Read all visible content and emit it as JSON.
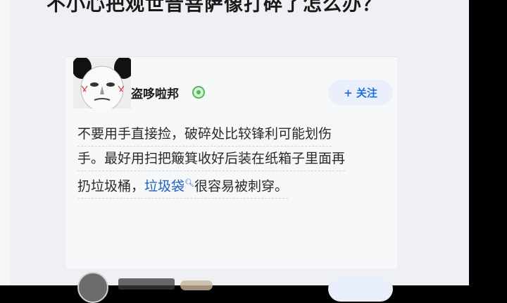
{
  "question": {
    "title": "不小心把观世音菩萨像打碎了怎么办？"
  },
  "answer": {
    "author": "盗哆啦邦",
    "author_badge_icon": "verified-badge-icon",
    "follow_label": "+ 关注",
    "lines": [
      "不要用手直接捡，破碎处比较锋利可能划伤",
      "手。最好用扫把簸箕收好后装在纸箱子里面再"
    ],
    "line3_before": "扔垃圾桶，",
    "keyword_link": "垃圾袋",
    "line3_after": "很容易被刺穿。"
  },
  "colors": {
    "link": "#1f5fbf",
    "follow_bg": "#e9f0fb",
    "badge": "#55b85b"
  }
}
